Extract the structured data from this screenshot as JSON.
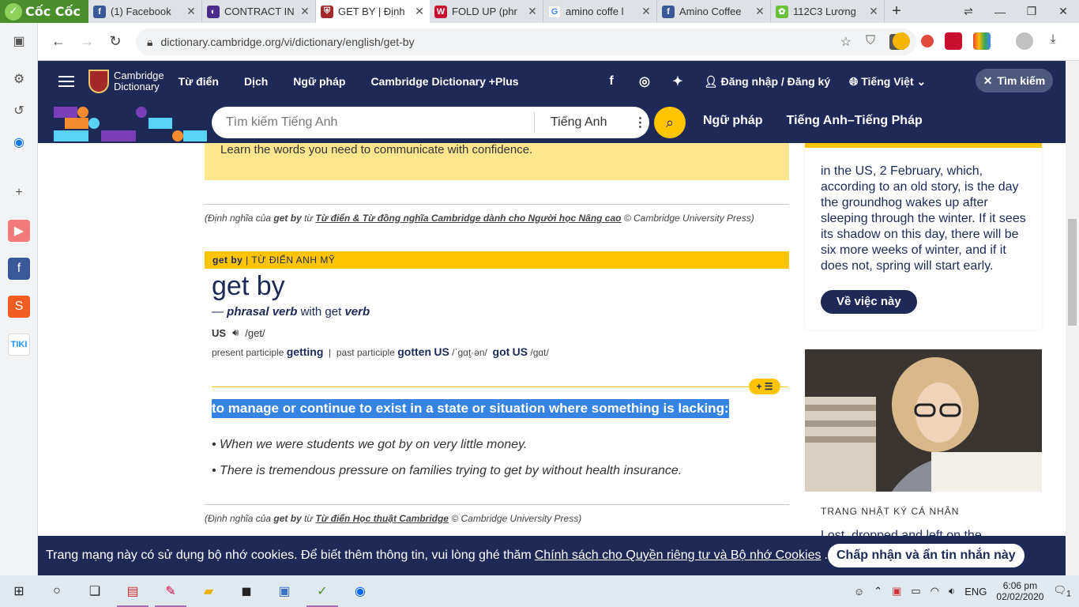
{
  "browser": {
    "brand": "Cốc Cốc",
    "tabs": [
      {
        "title": "(1) Facebook",
        "fav": "f",
        "color": "#3b5998"
      },
      {
        "title": "CONTRACT IN",
        "fav": "◐",
        "color": "#4a2b8c"
      },
      {
        "title": "GET BY | Định",
        "fav": "⛨",
        "color": "#a42a2a"
      },
      {
        "title": "FOLD UP (phr",
        "fav": "W",
        "color": "#c8102e"
      },
      {
        "title": "amino coffe l",
        "fav": "G",
        "color": "#4285f4"
      },
      {
        "title": "Amino Coffee",
        "fav": "f",
        "color": "#3b5998"
      },
      {
        "title": "112C3 Lương",
        "fav": "✿",
        "color": "#6abf3b"
      }
    ],
    "url": "dictionary.cambridge.org/vi/dictionary/english/get-by"
  },
  "site": {
    "brand_line1": "Cambridge",
    "brand_line2": "Dictionary",
    "nav": [
      "Từ điển",
      "Dịch",
      "Ngữ pháp",
      "Cambridge Dictionary +Plus"
    ],
    "login": "Đăng nhập / Đăng ký",
    "language": "Tiếng Việt",
    "search_button": "Tìm kiếm",
    "search_placeholder": "Tìm kiếm Tiếng Anh",
    "search_lang": "Tiếng Anh",
    "search_links": [
      "Ngữ pháp",
      "Tiếng Anh–Tiếng Pháp"
    ]
  },
  "content": {
    "promo_text": "Learn the words you need to communicate with confidence.",
    "credit1_pre": "(Định nghĩa của",
    "credit1_word": "get by",
    "credit1_mid": "từ",
    "credit1_source": "Từ điển & Từ đồng nghĩa Cambridge dành cho Người học Nâng cao",
    "credit1_post": "© Cambridge University Press)",
    "entry_label_word": "get by",
    "entry_label_dict": "TỪ ĐIỂN ANH MỸ",
    "headword": "get by",
    "pos_dash": "—",
    "pos": "phrasal verb",
    "pos_with": "with get",
    "pos_verb": "verb",
    "region": "US",
    "ipa": "/ɡet/",
    "forms": {
      "pp_label": "present participle",
      "pp": "getting",
      "past_label": "past participle",
      "past": "gotten",
      "past_region": "US",
      "past_ipa": "/ˈɡɑt̬·ən/",
      "alt": "got",
      "alt_region": "US",
      "alt_ipa": "/ɡɑt/"
    },
    "pill": "+ ☰",
    "definition": "to manage or continue to exist in a state or situation where something is lacking:",
    "examples": [
      "When we were students we got by on very little money.",
      "There is tremendous pressure on families trying to get by without health insurance."
    ],
    "credit2_pre": "(Định nghĩa của",
    "credit2_word": "get by",
    "credit2_mid": "từ",
    "credit2_source": "Từ điển Học thuật Cambridge",
    "credit2_post": "© Cambridge University Press)"
  },
  "sidebar_card": {
    "text": "in the US, 2 February, which, according to an old story, is the day the groundhog wakes up after sleeping through the winter. If it sees its shadow on this day, there will be six more weeks of winter, and if it does not, spring will start early.",
    "button": "Về việc này",
    "caption": "TRANG NHẬT KÝ CÁ NHÂN",
    "next_line": "Lost, dropped and left on the"
  },
  "cookie": {
    "text": "Trang mạng này có sử dụng bộ nhớ cookies. Để biết thêm thông tin, vui lòng ghé thăm",
    "link": "Chính sách cho Quyền riêng tư và Bộ nhớ Cookies",
    "end": ".",
    "accept": "Chấp nhận và ẩn tin nhắn này"
  },
  "taskbar": {
    "lang": "ENG",
    "time": "6:06 pm",
    "date": "02/02/2020",
    "notif_count": "1"
  }
}
